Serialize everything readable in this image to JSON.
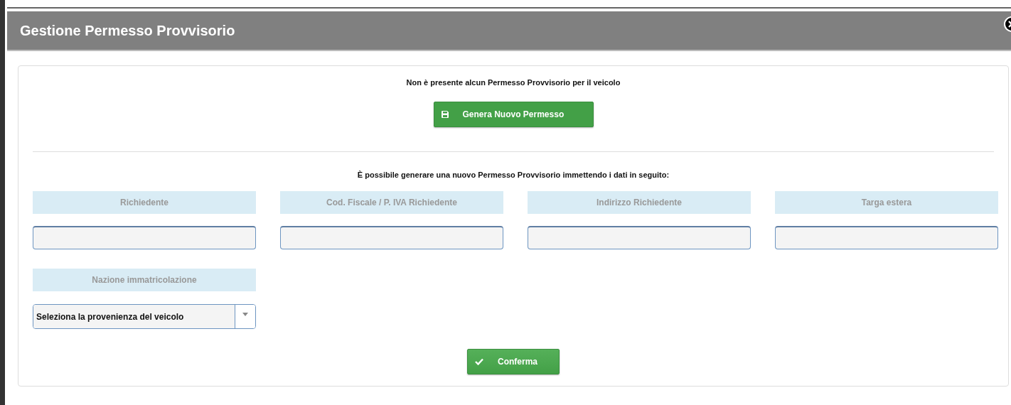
{
  "window": {
    "title": "Gestione Permesso Provvisorio"
  },
  "notice": "Non è presente alcun Permesso Provvisorio per il veicolo",
  "generate_button": {
    "label": "Genera Nuovo Permesso"
  },
  "instructions": "È possibile generare una nuovo Permesso Provvisorio immettendo i dati in seguito:",
  "fields": [
    {
      "kind": "text",
      "label": "Richiedente"
    },
    {
      "kind": "text",
      "label": "Cod. Fiscale / P. IVA Richiedente"
    },
    {
      "kind": "text",
      "label": "Indirizzo Richiedente"
    },
    {
      "kind": "text",
      "label": "Targa estera"
    },
    {
      "kind": "select",
      "label": "Nazione immatricolazione",
      "value": "Seleziona la provenienza del veicolo"
    }
  ],
  "confirm_button": {
    "label": "Conferma"
  }
}
